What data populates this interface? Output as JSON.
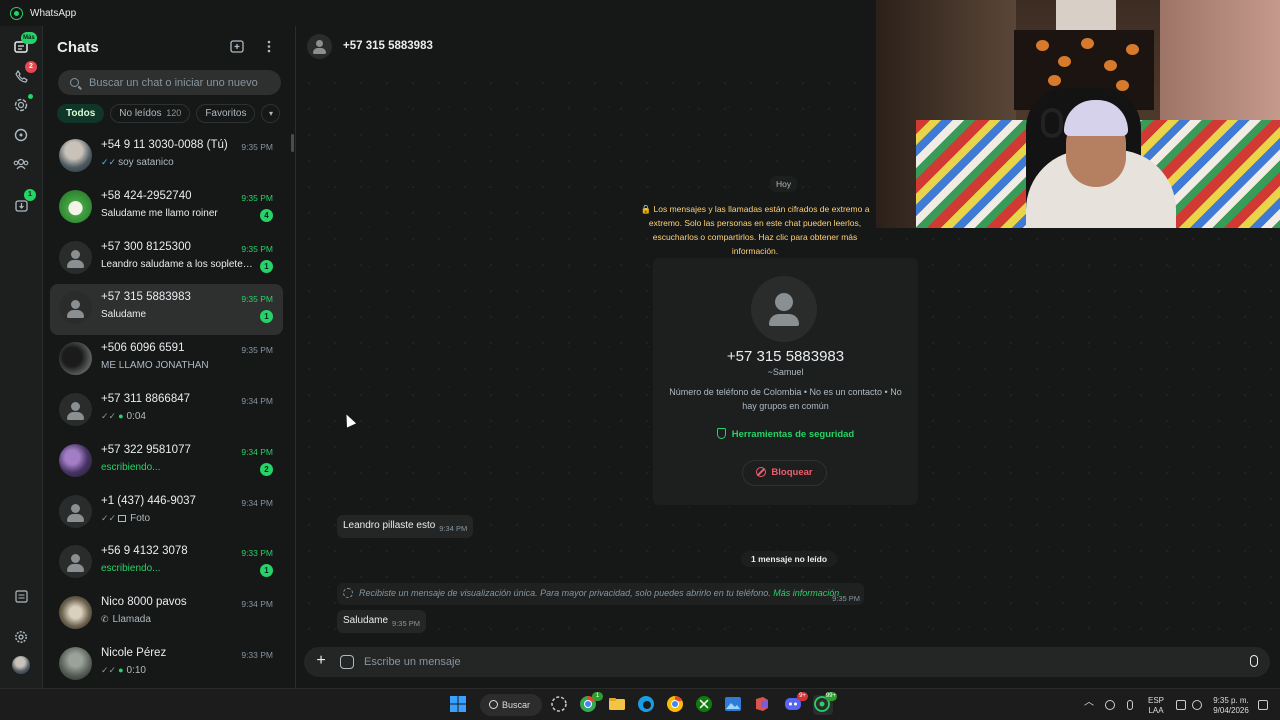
{
  "window": {
    "title": "WhatsApp"
  },
  "rail": {
    "chats_badge": "Más",
    "calls_badge": "2",
    "downloads_badge": "1"
  },
  "sidebar": {
    "title": "Chats",
    "search_placeholder": "Buscar un chat o iniciar uno nuevo",
    "filters": [
      {
        "label": "Todos",
        "count": ""
      },
      {
        "label": "No leídos",
        "count": "120"
      },
      {
        "label": "Favoritos",
        "count": ""
      }
    ],
    "chats": [
      {
        "name": "+54 9 11 3030-0088 (Tú)",
        "time": "9:35 PM",
        "message": "soy satanico",
        "tick": "✓✓",
        "tick_read": true,
        "unread": "",
        "avatar": "photo1"
      },
      {
        "name": "+58 424-2952740",
        "time": "9:35 PM",
        "message": "Saludame me llamo roiner",
        "tick": "",
        "unread": "4",
        "avatar": "photo2"
      },
      {
        "name": "+57 300 8125300",
        "time": "9:35 PM",
        "message": "Leandro saludame a los sopletes d...",
        "tick": "",
        "unread": "1",
        "avatar": "default"
      },
      {
        "name": "+57 315 5883983",
        "time": "9:35 PM",
        "message": "Saludame",
        "tick": "",
        "unread": "1",
        "avatar": "default",
        "selected": true
      },
      {
        "name": "+506 6096 6591",
        "time": "9:35 PM",
        "message": "ME LLAMO JONATHAN",
        "tick": "",
        "unread": "",
        "avatar": "photo3"
      },
      {
        "name": "+57 311 8866847",
        "time": "9:34 PM",
        "message": "0:04",
        "tick": "✓✓",
        "mic": true,
        "unread": "",
        "avatar": "default"
      },
      {
        "name": "+57 322 9581077",
        "time": "9:34 PM",
        "message": "escribiendo...",
        "tick": "",
        "typing": true,
        "unread": "2",
        "avatar": "photo4"
      },
      {
        "name": "+1 (437) 446-9037",
        "time": "9:34 PM",
        "message": "Foto",
        "tick": "✓✓",
        "photo": true,
        "unread": "",
        "avatar": "default"
      },
      {
        "name": "+56 9 4132 3078",
        "time": "9:33 PM",
        "message": "escribiendo...",
        "tick": "",
        "typing": true,
        "unread": "1",
        "avatar": "default"
      },
      {
        "name": "Nico 8000 pavos",
        "time": "9:34 PM",
        "message": "Llamada",
        "tick": "",
        "call": true,
        "unread": "",
        "avatar": "photo5"
      },
      {
        "name": "Nicole Pérez",
        "time": "9:33 PM",
        "message": "0:10",
        "tick": "✓✓",
        "mic": true,
        "unread": "",
        "avatar": "photo6"
      }
    ]
  },
  "conversation": {
    "contact": "+57 315 5883983",
    "date_chip": "Hoy",
    "encryption_notice": "🔒 Los mensajes y las llamadas están cifrados de extremo a extremo. Solo las personas en este chat pueden leerlos, escucharlos o compartirlos. Haz clic para obtener más información.",
    "card": {
      "phone": "+57 315 5883983",
      "alias": "~Samuel",
      "info": "Número de teléfono de Colombia • No es un contacto • No hay grupos en común",
      "security": "Herramientas de seguridad",
      "block": "Bloquear"
    },
    "messages": [
      {
        "text": "Leandro pillaste esto",
        "time": "9:34 PM"
      }
    ],
    "unread_separator": "1 mensaje no leído",
    "view_once": {
      "text": "Recibiste un mensaje de visualización única. Para mayor privacidad, solo puedes abrirlo en tu teléfono.",
      "link": "Más información",
      "time": "9:35 PM"
    },
    "last_message": {
      "text": "Saludame",
      "time": "9:35 PM"
    },
    "composer_placeholder": "Escribe un mensaje"
  },
  "taskbar": {
    "search_label": "Buscar",
    "lang": "ESP",
    "lang2": "LAA",
    "time": "9:35 p. m.",
    "date": "9/04/2026",
    "badges": {
      "chrome": "1",
      "discord": "9+",
      "whatsapp": "99+"
    }
  }
}
